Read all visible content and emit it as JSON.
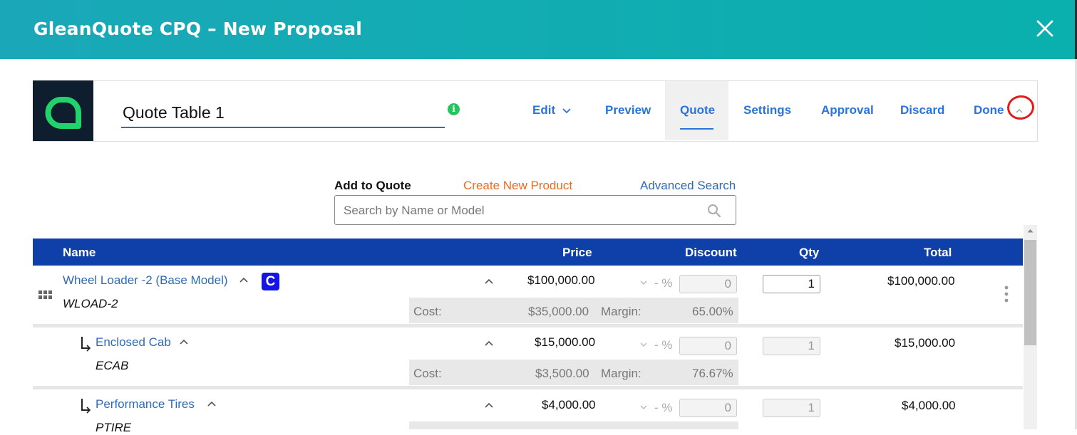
{
  "header": {
    "title": "GleanQuote CPQ – New Proposal"
  },
  "toolbar": {
    "quote_table_name": "Quote Table 1",
    "info_glyph": "i",
    "nav": {
      "edit": "Edit",
      "preview": "Preview",
      "quote": "Quote",
      "settings": "Settings",
      "approval": "Approval",
      "discard": "Discard",
      "done": "Done"
    }
  },
  "search": {
    "add_label": "Add to Quote",
    "create_link": "Create New Product",
    "advanced_link": "Advanced Search",
    "placeholder": "Search by Name or Model"
  },
  "table": {
    "headers": {
      "name": "Name",
      "price": "Price",
      "discount": "Discount",
      "qty": "Qty",
      "total": "Total"
    },
    "rows": [
      {
        "name": "Wheel Loader -2 (Base Model)",
        "model": "WLOAD-2",
        "badge": "C",
        "price": "$100,000.00",
        "discount": "0",
        "pct": "- %",
        "qty": "1",
        "total": "$100,000.00",
        "cost_label": "Cost:",
        "cost": "$35,000.00",
        "margin_label": "Margin:",
        "margin": "65.00%"
      },
      {
        "name": "Enclosed Cab",
        "model": "ECAB",
        "price": "$15,000.00",
        "discount": "0",
        "pct": "- %",
        "qty": "1",
        "total": "$15,000.00",
        "cost_label": "Cost:",
        "cost": "$3,500.00",
        "margin_label": "Margin:",
        "margin": "76.67%"
      },
      {
        "name": "Performance Tires",
        "model": "PTIRE",
        "price": "$4,000.00",
        "discount": "0",
        "pct": "- %",
        "qty": "1",
        "total": "$4,000.00"
      }
    ]
  },
  "colors": {
    "header_gradient_start": "#1aa8b8",
    "header_gradient_end": "#09b0ad",
    "table_header": "#0f3fa8",
    "link": "#2f6bb3",
    "nav": "#2a74d8",
    "create_link": "#ef6a1a",
    "badge": "#1414e6",
    "info": "#22c55e",
    "annotation": "#e21b1b"
  }
}
